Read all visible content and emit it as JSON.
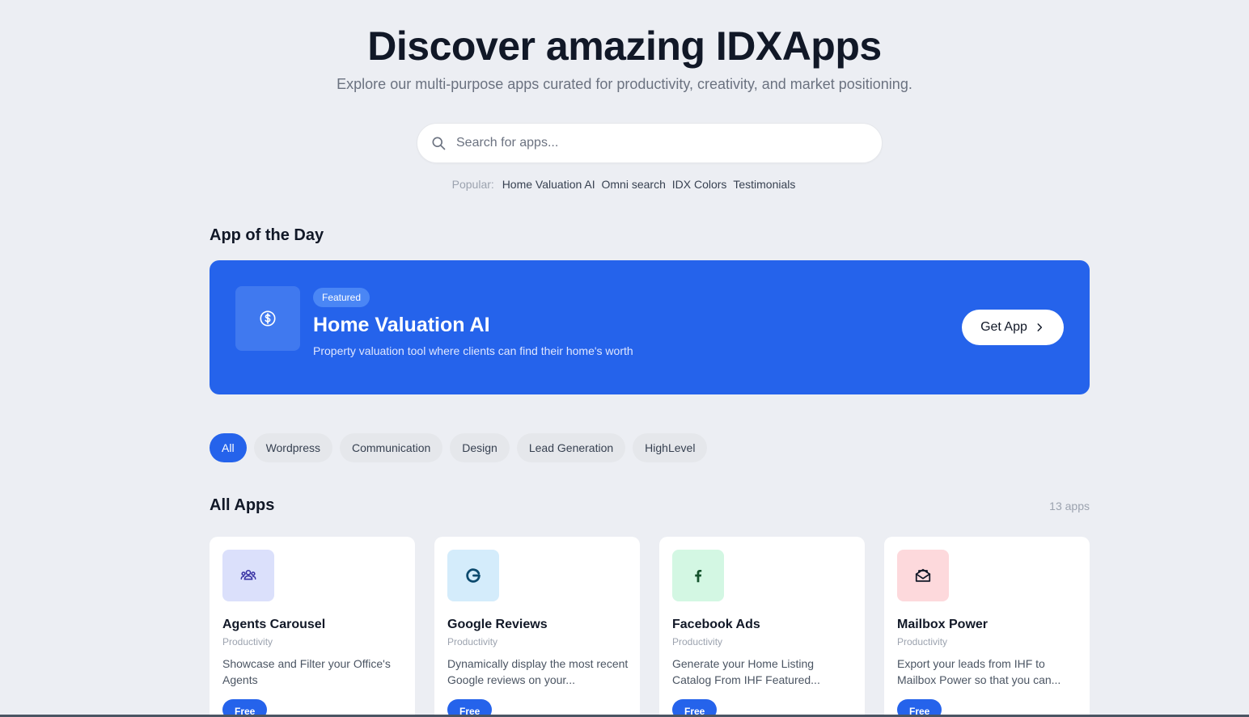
{
  "hero": {
    "title": "Discover amazing IDXApps",
    "subtitle": "Explore our multi-purpose apps curated for productivity, creativity, and market positioning."
  },
  "search": {
    "placeholder": "Search for apps...",
    "icon": "search-icon"
  },
  "popular": {
    "label": "Popular:",
    "tags": [
      "Home Valuation AI",
      "Omni search",
      "IDX Colors",
      "Testimonials"
    ]
  },
  "app_of_the_day": {
    "section_title": "App of the Day",
    "badge": "Featured",
    "title": "Home Valuation AI",
    "description": "Property valuation tool where clients can find their home's worth",
    "button_label": "Get App",
    "icon": "dollar-circle-icon",
    "accent_color": "#2563eb"
  },
  "filters": {
    "items": [
      "All",
      "Wordpress",
      "Communication",
      "Design",
      "Lead Generation",
      "HighLevel"
    ],
    "active": "All"
  },
  "apps": {
    "section_title": "All Apps",
    "count_label": "13 apps",
    "items": [
      {
        "name": "Agents Carousel",
        "category": "Productivity",
        "description": "Showcase and Filter your Office's Agents",
        "badge": "Free",
        "icon": "users-icon",
        "icon_bg": "#dbe0fb",
        "icon_color": "#3730a3"
      },
      {
        "name": "Google Reviews",
        "category": "Productivity",
        "description": "Dynamically display the most recent Google reviews on your...",
        "badge": "Free",
        "icon": "google-icon",
        "icon_bg": "#d4ecfb",
        "icon_color": "#0c4a6e"
      },
      {
        "name": "Facebook Ads",
        "category": "Productivity",
        "description": "Generate your Home Listing Catalog From IHF Featured...",
        "badge": "Free",
        "icon": "facebook-icon",
        "icon_bg": "#d3f7e3",
        "icon_color": "#14532d"
      },
      {
        "name": "Mailbox Power",
        "category": "Productivity",
        "description": "Export your leads from IHF to Mailbox Power so that you can...",
        "badge": "Free",
        "icon": "mail-open-icon",
        "icon_bg": "#fdd9dc",
        "icon_color": "#111827"
      }
    ]
  }
}
